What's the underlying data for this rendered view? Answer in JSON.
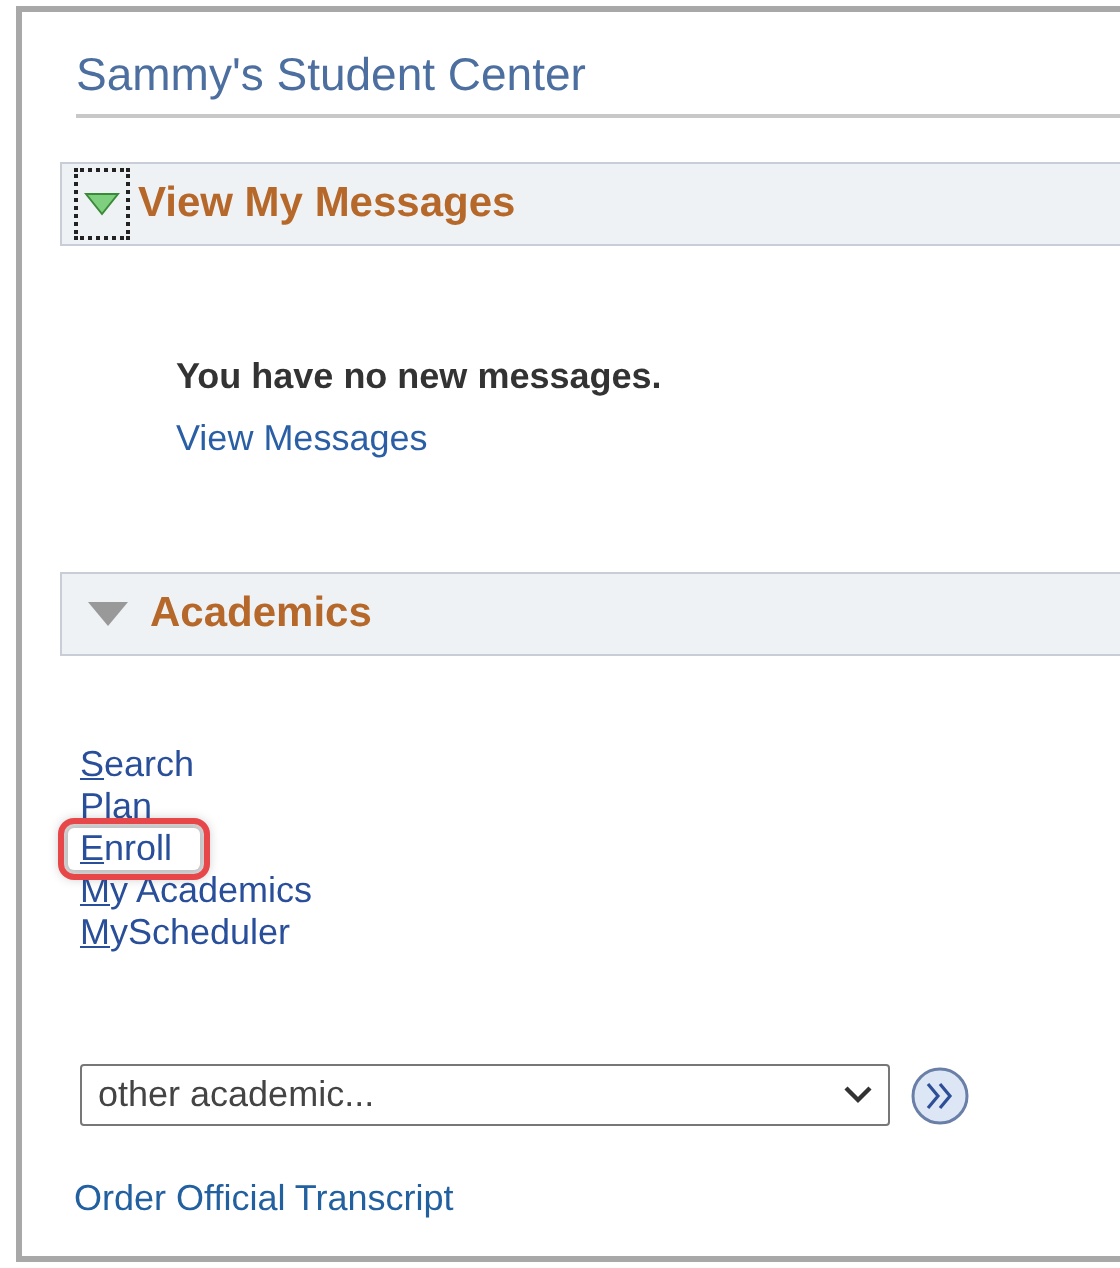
{
  "title": "Sammy's Student Center",
  "messages": {
    "header": "View My Messages",
    "expanded": true,
    "focused": true,
    "text": "You have no new messages.",
    "link": "View Messages"
  },
  "academics": {
    "header": "Academics",
    "expanded": true,
    "links": [
      {
        "label": "Search",
        "highlighted": false
      },
      {
        "label": "Plan",
        "highlighted": false
      },
      {
        "label": "Enroll",
        "highlighted": true
      },
      {
        "label": "My Academics",
        "highlighted": false
      },
      {
        "label": "MyScheduler",
        "highlighted": false
      }
    ],
    "select": {
      "value": "other academic..."
    },
    "footer_link": "Order Official Transcript"
  }
}
